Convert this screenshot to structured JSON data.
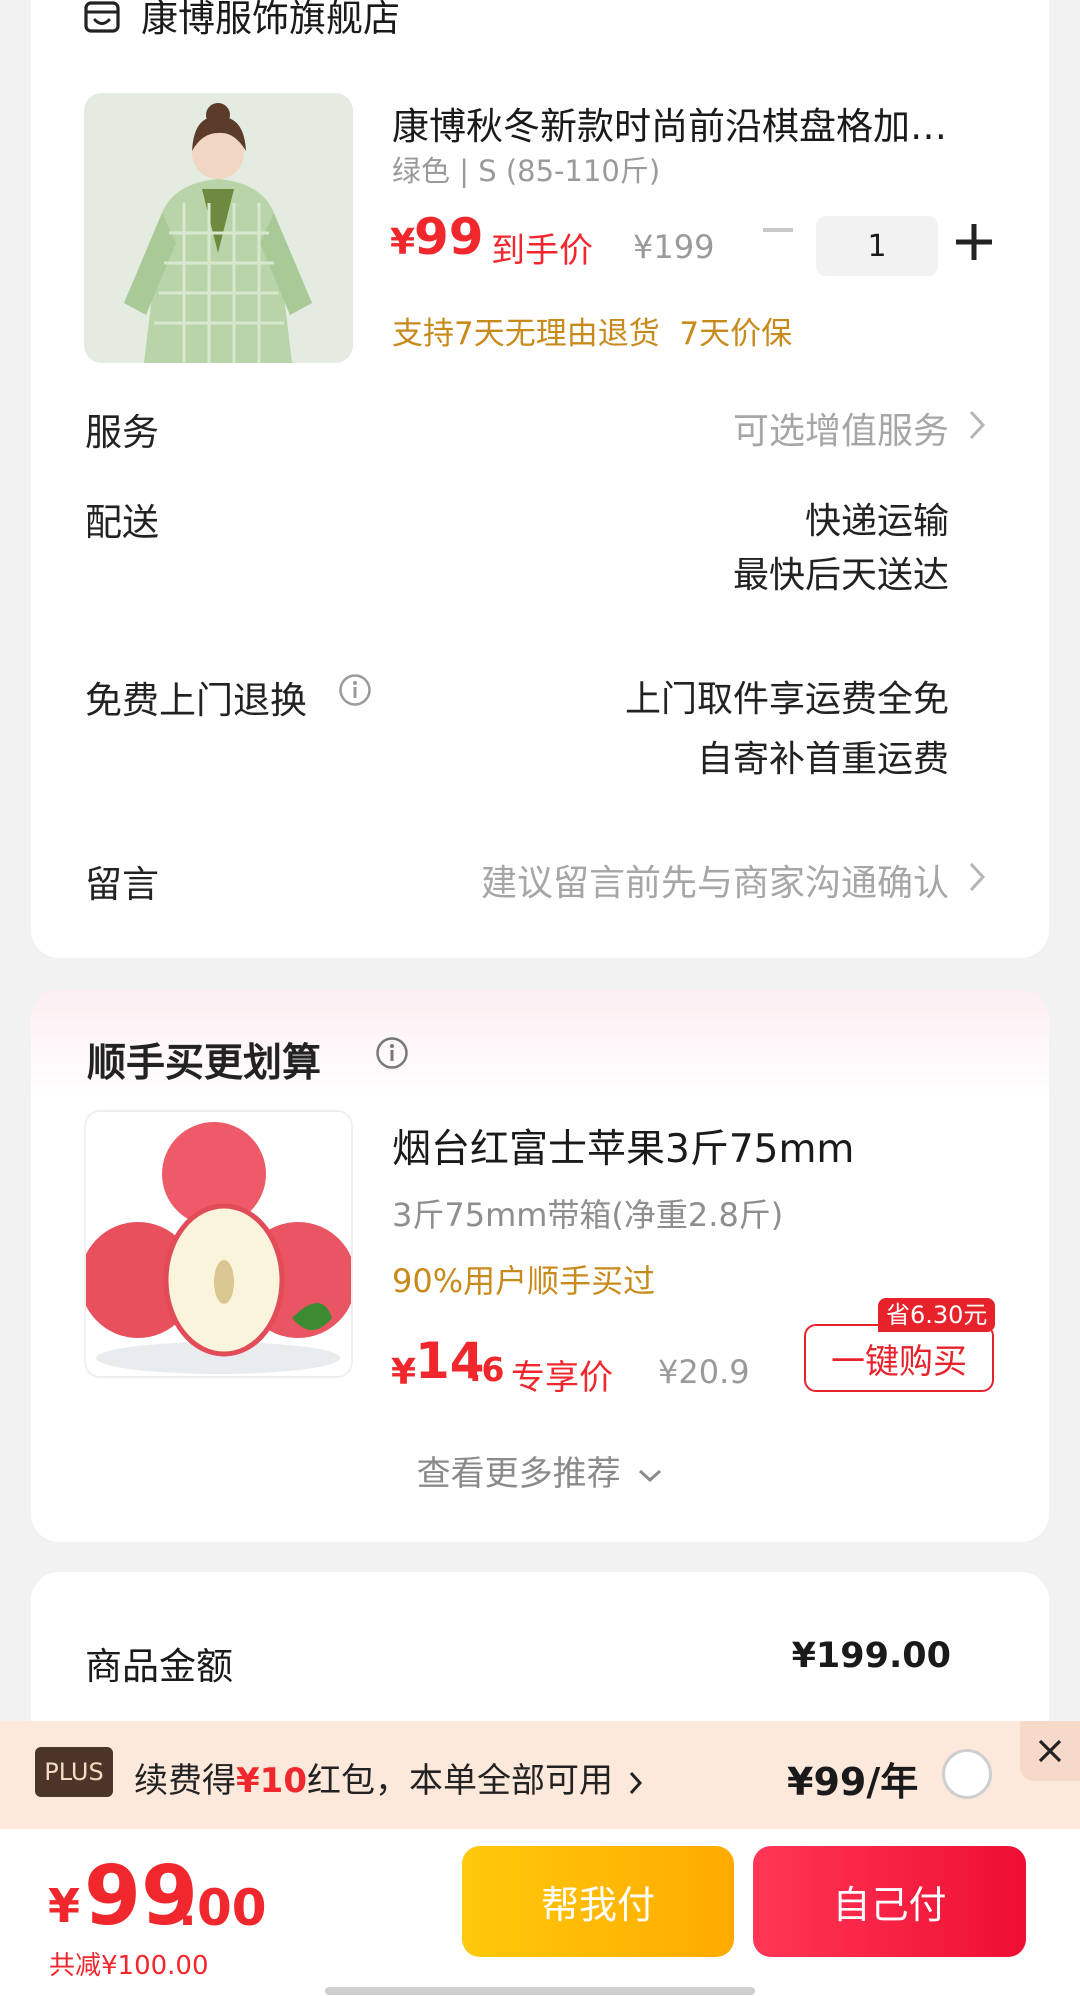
{
  "store": {
    "name": "康博服饰旗舰店",
    "icon": "store-icon"
  },
  "product": {
    "title": "康博秋冬新款时尚前沿棋盘格加…",
    "spec": "绿色 | S (85-110斤)",
    "currency": "¥",
    "price": "99",
    "price_label": "到手价",
    "original_price": "¥199",
    "quantity": "1",
    "service_tags": "支持7天无理由退货  7天价保"
  },
  "rows": {
    "service": {
      "label": "服务",
      "value": "可选增值服务"
    },
    "delivery": {
      "label": "配送",
      "value_line1": "快递运输",
      "value_line2": "最快后天送达"
    },
    "return": {
      "label": "免费上门退换",
      "value_line1": "上门取件享运费全免",
      "value_line2": "自寄补首重运费"
    },
    "message": {
      "label": "留言",
      "placeholder": "建议留言前先与商家沟通确认"
    }
  },
  "recommend": {
    "title": "顺手买更划算",
    "item": {
      "title": "烟台红富士苹果3斤75mm",
      "spec": "3斤75mm带箱(净重2.8斤)",
      "hint": "90%用户顺手买过",
      "currency": "¥",
      "price_int": "14",
      "price_dec": ".6",
      "price_label": "专享价",
      "original_price": "¥20.9",
      "save_tag": "省6.30元",
      "buy_label": "一键购买"
    },
    "more_label": "查看更多推荐"
  },
  "summary": {
    "amount_label": "商品金额",
    "amount_value": "¥199.00"
  },
  "plus": {
    "badge": "PLUS",
    "text_prefix": "续费得",
    "text_highlight": "¥10",
    "text_suffix": "红包，本单全部可用",
    "price": "¥99/年"
  },
  "checkout": {
    "currency": "¥",
    "total_int": "99",
    "total_dec": ".00",
    "discount": "共减¥100.00",
    "help_pay": "帮我付",
    "self_pay": "自己付"
  },
  "colors": {
    "accent_red": "#f0272c",
    "gold": "#c98a1c",
    "help_yellow": "#ffb400",
    "pay_red": "#ee0e33"
  }
}
